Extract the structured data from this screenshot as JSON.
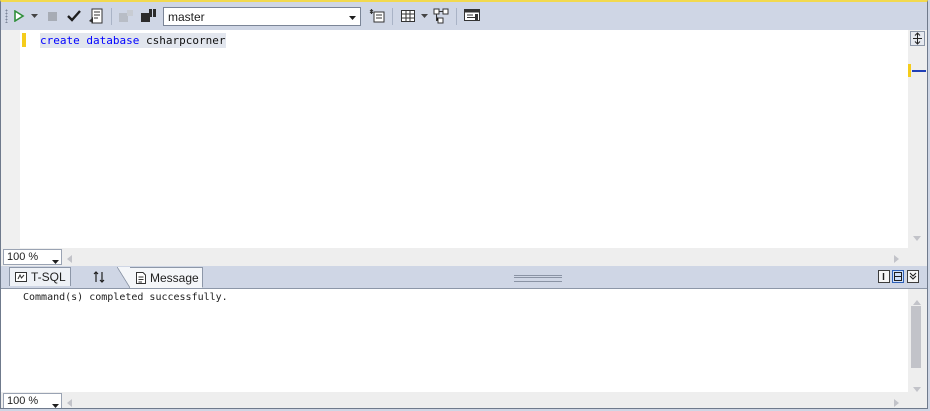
{
  "toolbar": {
    "database": "master",
    "icons": [
      "execute-icon",
      "dropdown-arrow-icon",
      "stop-icon",
      "parse-checkmark-icon",
      "display-estimated-plan-icon",
      "connect-icon",
      "change-connection-icon",
      "query-options-icon",
      "results-to-grid-icon",
      "show-plan-icon",
      "include-client-stats-icon"
    ]
  },
  "editor": {
    "code": {
      "kw1": "create",
      "kw2": "database",
      "name": "csharpcorner"
    },
    "zoom": "100 %"
  },
  "results": {
    "tabs": [
      {
        "label": "T-SQL"
      },
      {
        "label": ""
      },
      {
        "label": "Message"
      }
    ],
    "message": "Command(s) completed successfully.",
    "zoom": "100 %"
  },
  "colors": {
    "keyword": "#0000ff",
    "change_marker": "#f5cc1b",
    "toolbar_bg": "#cfd6e5",
    "selection": "#e2e6ee"
  }
}
